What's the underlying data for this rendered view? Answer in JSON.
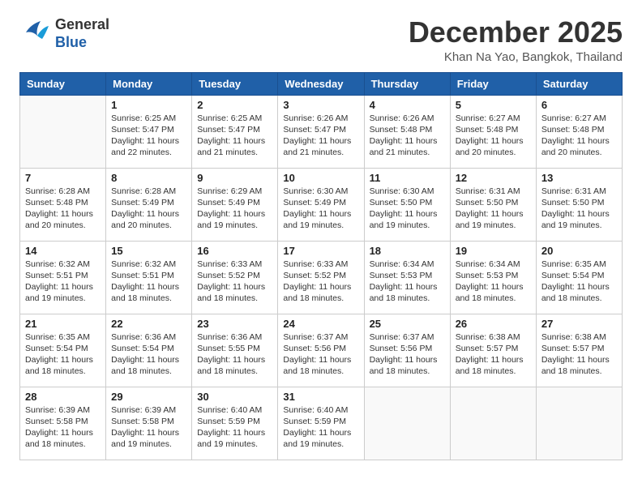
{
  "header": {
    "logo_line1": "General",
    "logo_line2": "Blue",
    "month": "December 2025",
    "location": "Khan Na Yao, Bangkok, Thailand"
  },
  "weekdays": [
    "Sunday",
    "Monday",
    "Tuesday",
    "Wednesday",
    "Thursday",
    "Friday",
    "Saturday"
  ],
  "weeks": [
    [
      {
        "day": "",
        "sunrise": "",
        "sunset": "",
        "daylight": ""
      },
      {
        "day": "1",
        "sunrise": "6:25 AM",
        "sunset": "5:47 PM",
        "daylight": "11 hours and 22 minutes."
      },
      {
        "day": "2",
        "sunrise": "6:25 AM",
        "sunset": "5:47 PM",
        "daylight": "11 hours and 21 minutes."
      },
      {
        "day": "3",
        "sunrise": "6:26 AM",
        "sunset": "5:47 PM",
        "daylight": "11 hours and 21 minutes."
      },
      {
        "day": "4",
        "sunrise": "6:26 AM",
        "sunset": "5:48 PM",
        "daylight": "11 hours and 21 minutes."
      },
      {
        "day": "5",
        "sunrise": "6:27 AM",
        "sunset": "5:48 PM",
        "daylight": "11 hours and 20 minutes."
      },
      {
        "day": "6",
        "sunrise": "6:27 AM",
        "sunset": "5:48 PM",
        "daylight": "11 hours and 20 minutes."
      }
    ],
    [
      {
        "day": "7",
        "sunrise": "6:28 AM",
        "sunset": "5:48 PM",
        "daylight": "11 hours and 20 minutes."
      },
      {
        "day": "8",
        "sunrise": "6:28 AM",
        "sunset": "5:49 PM",
        "daylight": "11 hours and 20 minutes."
      },
      {
        "day": "9",
        "sunrise": "6:29 AM",
        "sunset": "5:49 PM",
        "daylight": "11 hours and 19 minutes."
      },
      {
        "day": "10",
        "sunrise": "6:30 AM",
        "sunset": "5:49 PM",
        "daylight": "11 hours and 19 minutes."
      },
      {
        "day": "11",
        "sunrise": "6:30 AM",
        "sunset": "5:50 PM",
        "daylight": "11 hours and 19 minutes."
      },
      {
        "day": "12",
        "sunrise": "6:31 AM",
        "sunset": "5:50 PM",
        "daylight": "11 hours and 19 minutes."
      },
      {
        "day": "13",
        "sunrise": "6:31 AM",
        "sunset": "5:50 PM",
        "daylight": "11 hours and 19 minutes."
      }
    ],
    [
      {
        "day": "14",
        "sunrise": "6:32 AM",
        "sunset": "5:51 PM",
        "daylight": "11 hours and 19 minutes."
      },
      {
        "day": "15",
        "sunrise": "6:32 AM",
        "sunset": "5:51 PM",
        "daylight": "11 hours and 18 minutes."
      },
      {
        "day": "16",
        "sunrise": "6:33 AM",
        "sunset": "5:52 PM",
        "daylight": "11 hours and 18 minutes."
      },
      {
        "day": "17",
        "sunrise": "6:33 AM",
        "sunset": "5:52 PM",
        "daylight": "11 hours and 18 minutes."
      },
      {
        "day": "18",
        "sunrise": "6:34 AM",
        "sunset": "5:53 PM",
        "daylight": "11 hours and 18 minutes."
      },
      {
        "day": "19",
        "sunrise": "6:34 AM",
        "sunset": "5:53 PM",
        "daylight": "11 hours and 18 minutes."
      },
      {
        "day": "20",
        "sunrise": "6:35 AM",
        "sunset": "5:54 PM",
        "daylight": "11 hours and 18 minutes."
      }
    ],
    [
      {
        "day": "21",
        "sunrise": "6:35 AM",
        "sunset": "5:54 PM",
        "daylight": "11 hours and 18 minutes."
      },
      {
        "day": "22",
        "sunrise": "6:36 AM",
        "sunset": "5:54 PM",
        "daylight": "11 hours and 18 minutes."
      },
      {
        "day": "23",
        "sunrise": "6:36 AM",
        "sunset": "5:55 PM",
        "daylight": "11 hours and 18 minutes."
      },
      {
        "day": "24",
        "sunrise": "6:37 AM",
        "sunset": "5:56 PM",
        "daylight": "11 hours and 18 minutes."
      },
      {
        "day": "25",
        "sunrise": "6:37 AM",
        "sunset": "5:56 PM",
        "daylight": "11 hours and 18 minutes."
      },
      {
        "day": "26",
        "sunrise": "6:38 AM",
        "sunset": "5:57 PM",
        "daylight": "11 hours and 18 minutes."
      },
      {
        "day": "27",
        "sunrise": "6:38 AM",
        "sunset": "5:57 PM",
        "daylight": "11 hours and 18 minutes."
      }
    ],
    [
      {
        "day": "28",
        "sunrise": "6:39 AM",
        "sunset": "5:58 PM",
        "daylight": "11 hours and 18 minutes."
      },
      {
        "day": "29",
        "sunrise": "6:39 AM",
        "sunset": "5:58 PM",
        "daylight": "11 hours and 19 minutes."
      },
      {
        "day": "30",
        "sunrise": "6:40 AM",
        "sunset": "5:59 PM",
        "daylight": "11 hours and 19 minutes."
      },
      {
        "day": "31",
        "sunrise": "6:40 AM",
        "sunset": "5:59 PM",
        "daylight": "11 hours and 19 minutes."
      },
      {
        "day": "",
        "sunrise": "",
        "sunset": "",
        "daylight": ""
      },
      {
        "day": "",
        "sunrise": "",
        "sunset": "",
        "daylight": ""
      },
      {
        "day": "",
        "sunrise": "",
        "sunset": "",
        "daylight": ""
      }
    ]
  ]
}
